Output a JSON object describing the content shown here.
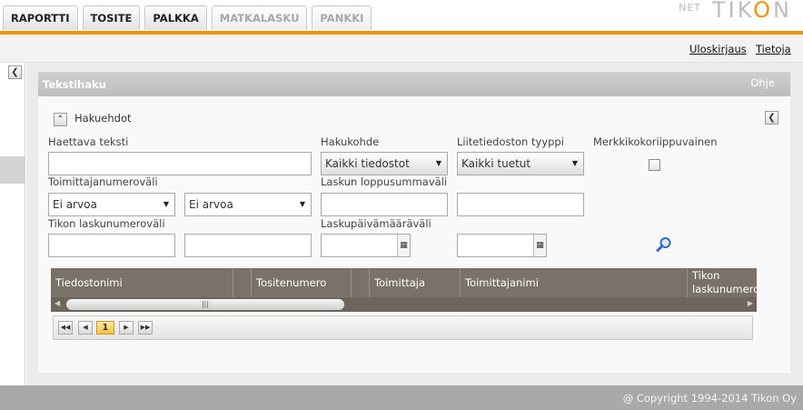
{
  "tabs": [
    {
      "label": "RAPORTTI",
      "enabled": true
    },
    {
      "label": "TOSITE",
      "enabled": true
    },
    {
      "label": "PALKKA",
      "enabled": true
    },
    {
      "label": "MATKALASKU",
      "enabled": false
    },
    {
      "label": "PANKKI",
      "enabled": false
    }
  ],
  "logo": {
    "prefix": "NET",
    "name_a": "TIK",
    "name_o": "O",
    "name_b": "N"
  },
  "colors": {
    "accent": "#f39200",
    "panel_header": "#c4c4c4",
    "grid_header": "#7a7168"
  },
  "userbar": {
    "logout": "Uloskirjaus",
    "info": "Tietoja"
  },
  "panel": {
    "title": "Tekstihaku",
    "help": "Ohje",
    "section": "Hakuehdot",
    "fields": {
      "search_text_label": "Haettava teksti",
      "search_text_value": "",
      "target_label": "Hakukohde",
      "target_value": "Kaikki tiedostot",
      "attachment_type_label": "Liitetiedoston tyyppi",
      "attachment_type_value": "Kaikki tuetut",
      "case_sensitive_label": "Merkkikokoriippuvainen",
      "case_sensitive_checked": false,
      "supplier_range_label": "Toimittajanumeroväli",
      "supplier_from": "Ei arvoa",
      "supplier_to": "Ei arvoa",
      "invoice_sum_label": "Laskun loppusummaväli",
      "tikon_invoice_range_label": "Tikon laskunumeroväli",
      "invoice_date_label": "Laskupäivämääräväli"
    },
    "grid": {
      "columns": [
        "Tiedostonimi",
        "",
        "Tositenumero",
        "",
        "Toimittaja",
        "Toimittajanimi",
        "Tikon laskunumero"
      ],
      "rows": []
    },
    "pager": {
      "current_page": "1"
    }
  },
  "icons": {
    "collapse": "chevron-left-icon",
    "expand": "chevron-up-icon",
    "search": "magnifier-icon",
    "calendar": "calendar-icon"
  },
  "footer": {
    "copyright": "@ Copyright 1994-2014 Tikon Oy"
  }
}
